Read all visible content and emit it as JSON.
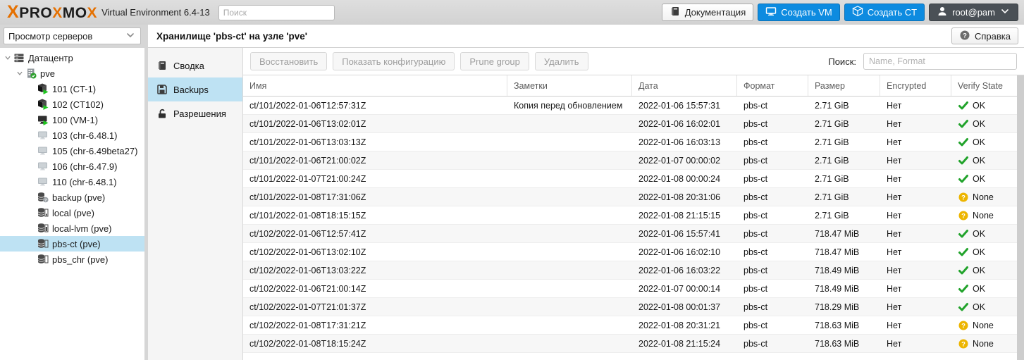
{
  "colors": {
    "brand_orange": "#e57000",
    "primary_blue": "#0d8be0",
    "ok_green": "#21a32b",
    "warn_yellow": "#edb500",
    "selection_blue": "#bee2f3"
  },
  "header": {
    "logo_parts": [
      {
        "text": "X",
        "orange": true,
        "first": true
      },
      {
        "text": "PRO",
        "orange": false
      },
      {
        "text": "X",
        "orange": true
      },
      {
        "text": "MO",
        "orange": false
      },
      {
        "text": "X",
        "orange": true
      }
    ],
    "subtitle": "Virtual Environment 6.4-13",
    "search_placeholder": "Поиск",
    "buttons": {
      "docs": "Документация",
      "create_vm": "Создать VM",
      "create_ct": "Создать CT",
      "user": "root@pam"
    }
  },
  "sidebar": {
    "view_select": "Просмотр серверов",
    "tree": [
      {
        "label": "Датацентр",
        "level": 0,
        "icon": "server",
        "expandable": true
      },
      {
        "label": "pve",
        "level": 1,
        "icon": "node-online",
        "expandable": true
      },
      {
        "label": "101 (CT-1)",
        "level": 2,
        "icon": "ct-running"
      },
      {
        "label": "102 (CT102)",
        "level": 2,
        "icon": "ct-running"
      },
      {
        "label": "100 (VM-1)",
        "level": 2,
        "icon": "vm-running"
      },
      {
        "label": "103 (chr-6.48.1)",
        "level": 2,
        "icon": "vm-stopped"
      },
      {
        "label": "105 (chr-6.49beta27)",
        "level": 2,
        "icon": "vm-stopped"
      },
      {
        "label": "106 (chr-6.47.9)",
        "level": 2,
        "icon": "vm-stopped"
      },
      {
        "label": "110 (chr-6.48.1)",
        "level": 2,
        "icon": "vm-stopped"
      },
      {
        "label": "backup (pve)",
        "level": 2,
        "icon": "storage-question"
      },
      {
        "label": "local (pve)",
        "level": 2,
        "icon": "storage-local"
      },
      {
        "label": "local-lvm (pve)",
        "level": 2,
        "icon": "storage-lvm"
      },
      {
        "label": "pbs-ct (pve)",
        "level": 2,
        "icon": "storage-pbs",
        "selected": true
      },
      {
        "label": "pbs_chr (pve)",
        "level": 2,
        "icon": "storage-pbs"
      }
    ]
  },
  "content": {
    "title": "Хранилище 'pbs-ct' на узле 'pve'",
    "help_button": "Справка",
    "tabs": [
      {
        "label": "Сводка",
        "icon": "book",
        "active": false
      },
      {
        "label": "Backups",
        "icon": "floppy",
        "active": true
      },
      {
        "label": "Разрешения",
        "icon": "unlock",
        "active": false
      }
    ],
    "toolbar": {
      "buttons": [
        "Восстановить",
        "Показать конфигурацию",
        "Prune group",
        "Удалить"
      ],
      "search_label": "Поиск:",
      "search_placeholder": "Name, Format"
    },
    "table": {
      "columns": [
        "Имя",
        "Заметки",
        "Дата",
        "Формат",
        "Размер",
        "Encrypted",
        "Verify State"
      ],
      "rows": [
        {
          "name": "ct/101/2022-01-06T12:57:31Z",
          "notes": "Копия перед обновлением",
          "date": "2022-01-06 15:57:31",
          "format": "pbs-ct",
          "size": "2.71 GiB",
          "encrypted": "Нет",
          "verify": "OK"
        },
        {
          "name": "ct/101/2022-01-06T13:02:01Z",
          "notes": "",
          "date": "2022-01-06 16:02:01",
          "format": "pbs-ct",
          "size": "2.71 GiB",
          "encrypted": "Нет",
          "verify": "OK"
        },
        {
          "name": "ct/101/2022-01-06T13:03:13Z",
          "notes": "",
          "date": "2022-01-06 16:03:13",
          "format": "pbs-ct",
          "size": "2.71 GiB",
          "encrypted": "Нет",
          "verify": "OK"
        },
        {
          "name": "ct/101/2022-01-06T21:00:02Z",
          "notes": "",
          "date": "2022-01-07 00:00:02",
          "format": "pbs-ct",
          "size": "2.71 GiB",
          "encrypted": "Нет",
          "verify": "OK"
        },
        {
          "name": "ct/101/2022-01-07T21:00:24Z",
          "notes": "",
          "date": "2022-01-08 00:00:24",
          "format": "pbs-ct",
          "size": "2.71 GiB",
          "encrypted": "Нет",
          "verify": "OK"
        },
        {
          "name": "ct/101/2022-01-08T17:31:06Z",
          "notes": "",
          "date": "2022-01-08 20:31:06",
          "format": "pbs-ct",
          "size": "2.71 GiB",
          "encrypted": "Нет",
          "verify": "None"
        },
        {
          "name": "ct/101/2022-01-08T18:15:15Z",
          "notes": "",
          "date": "2022-01-08 21:15:15",
          "format": "pbs-ct",
          "size": "2.71 GiB",
          "encrypted": "Нет",
          "verify": "None"
        },
        {
          "name": "ct/102/2022-01-06T12:57:41Z",
          "notes": "",
          "date": "2022-01-06 15:57:41",
          "format": "pbs-ct",
          "size": "718.47 MiB",
          "encrypted": "Нет",
          "verify": "OK"
        },
        {
          "name": "ct/102/2022-01-06T13:02:10Z",
          "notes": "",
          "date": "2022-01-06 16:02:10",
          "format": "pbs-ct",
          "size": "718.47 MiB",
          "encrypted": "Нет",
          "verify": "OK"
        },
        {
          "name": "ct/102/2022-01-06T13:03:22Z",
          "notes": "",
          "date": "2022-01-06 16:03:22",
          "format": "pbs-ct",
          "size": "718.49 MiB",
          "encrypted": "Нет",
          "verify": "OK"
        },
        {
          "name": "ct/102/2022-01-06T21:00:14Z",
          "notes": "",
          "date": "2022-01-07 00:00:14",
          "format": "pbs-ct",
          "size": "718.49 MiB",
          "encrypted": "Нет",
          "verify": "OK"
        },
        {
          "name": "ct/102/2022-01-07T21:01:37Z",
          "notes": "",
          "date": "2022-01-08 00:01:37",
          "format": "pbs-ct",
          "size": "718.29 MiB",
          "encrypted": "Нет",
          "verify": "OK"
        },
        {
          "name": "ct/102/2022-01-08T17:31:21Z",
          "notes": "",
          "date": "2022-01-08 20:31:21",
          "format": "pbs-ct",
          "size": "718.63 MiB",
          "encrypted": "Нет",
          "verify": "None"
        },
        {
          "name": "ct/102/2022-01-08T18:15:24Z",
          "notes": "",
          "date": "2022-01-08 21:15:24",
          "format": "pbs-ct",
          "size": "718.63 MiB",
          "encrypted": "Нет",
          "verify": "None"
        }
      ]
    }
  }
}
